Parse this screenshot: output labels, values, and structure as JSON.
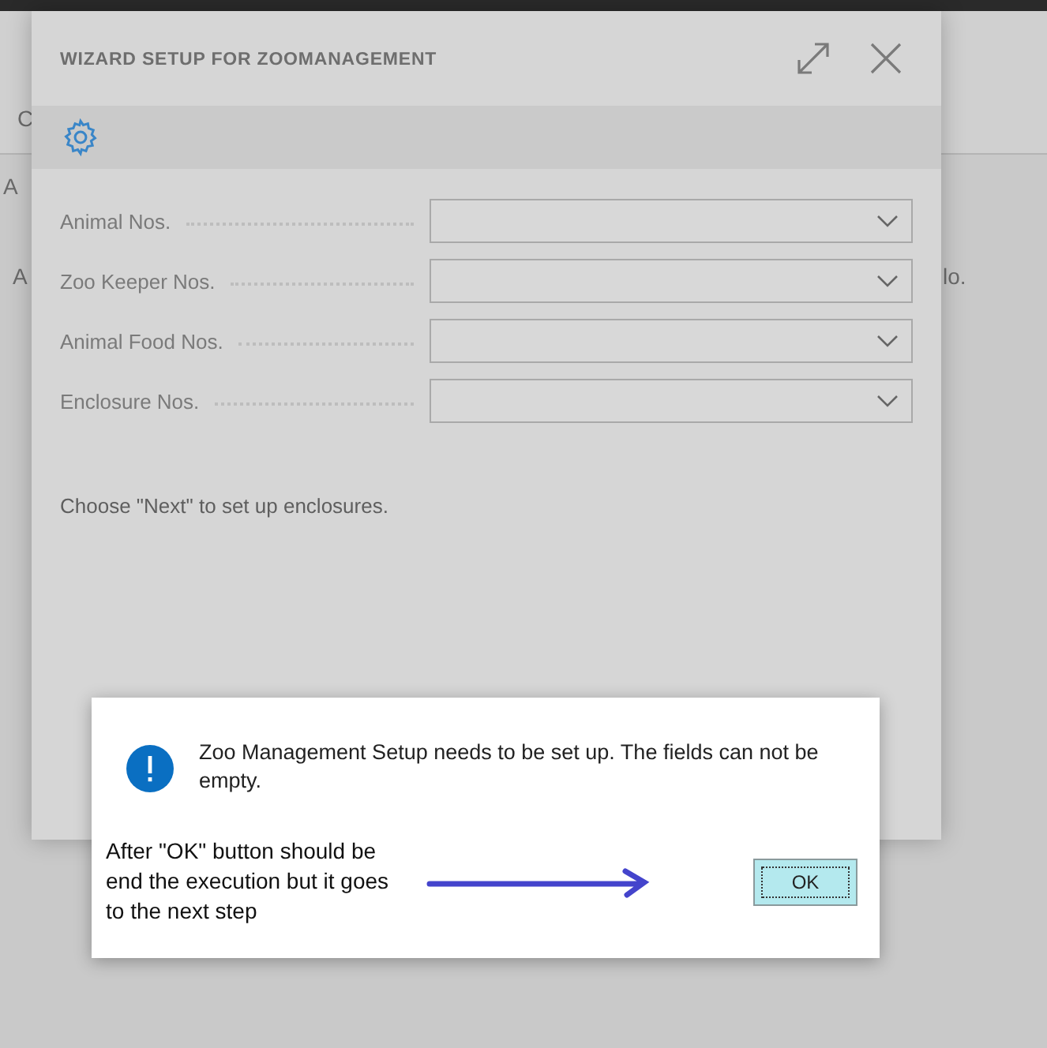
{
  "background_page": {
    "fragments": [
      "C",
      "A",
      "A",
      "lo."
    ]
  },
  "wizard": {
    "title": "WIZARD SETUP FOR ZOOMANAGEMENT",
    "fields": [
      {
        "label": "Animal Nos."
      },
      {
        "label": "Zoo Keeper Nos."
      },
      {
        "label": "Animal Food Nos."
      },
      {
        "label": "Enclosure Nos."
      }
    ],
    "instruction": "Choose \"Next\" to set up enclosures."
  },
  "message_box": {
    "text": "Zoo Management Setup needs to be set up. The fields can not be empty.",
    "ok_button": "OK"
  },
  "annotation": {
    "text": "After \"OK\" button should be end the execution but it goes to the next step"
  }
}
